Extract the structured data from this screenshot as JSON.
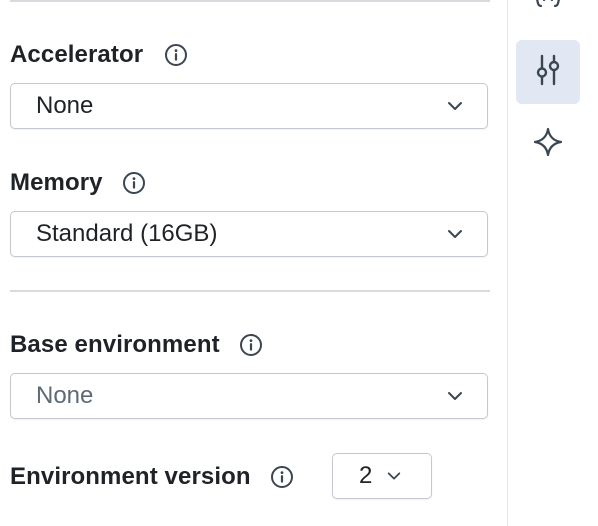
{
  "settings": {
    "accelerator": {
      "label": "Accelerator",
      "value": "None"
    },
    "memory": {
      "label": "Memory",
      "value": "Standard (16GB)"
    },
    "base_environment": {
      "label": "Base environment",
      "placeholder": "None"
    },
    "environment_version": {
      "label": "Environment version",
      "value": "2"
    }
  },
  "rail": {
    "items": [
      {
        "icon": "variables-icon",
        "active": false
      },
      {
        "icon": "sliders-icon",
        "active": true
      },
      {
        "icon": "sparkle-icon",
        "active": false
      }
    ]
  },
  "colors": {
    "active_rail_bg": "#e1e8f3",
    "icon_color": "#3b4653"
  }
}
